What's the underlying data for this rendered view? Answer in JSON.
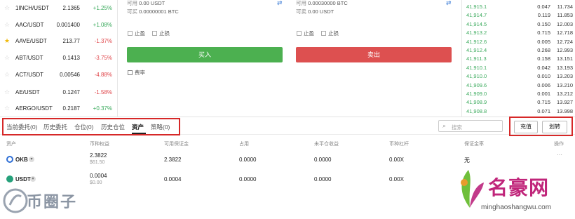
{
  "market": [
    {
      "pair": "1INCH/USDT",
      "price": "2.1365",
      "change": "+1.25%",
      "dir": "up",
      "starred": false
    },
    {
      "pair": "AAC/USDT",
      "price": "0.001400",
      "change": "+1.08%",
      "dir": "up",
      "starred": false
    },
    {
      "pair": "AAVE/USDT",
      "price": "213.77",
      "change": "-1.37%",
      "dir": "down",
      "starred": true
    },
    {
      "pair": "ABT/USDT",
      "price": "0.1413",
      "change": "-3.75%",
      "dir": "down",
      "starred": false
    },
    {
      "pair": "ACT/USDT",
      "price": "0.00546",
      "change": "-4.88%",
      "dir": "down",
      "starred": false
    },
    {
      "pair": "AE/USDT",
      "price": "0.1247",
      "change": "-1.58%",
      "dir": "down",
      "starred": false
    },
    {
      "pair": "AERGO/USDT",
      "price": "0.2187",
      "change": "+0.37%",
      "dir": "up",
      "starred": false
    }
  ],
  "order": {
    "buy": {
      "avail_label": "可用",
      "avail_value": "0.00 USDT",
      "max_label": "可买",
      "max_value": "0.00000001 BTC",
      "btn": "买入"
    },
    "sell": {
      "avail_label": "可用",
      "avail_value": "0.00030000 BTC",
      "max_label": "可卖",
      "max_value": "0.00 USDT",
      "btn": "卖出"
    },
    "tp": "止盈",
    "sl": "止损",
    "fee": "费率"
  },
  "book": [
    {
      "price": "41,915.1",
      "amount": "0.047",
      "total": "11.734"
    },
    {
      "price": "41,914.7",
      "amount": "0.119",
      "total": "11.853"
    },
    {
      "price": "41,914.5",
      "amount": "0.150",
      "total": "12.003"
    },
    {
      "price": "41,913.2",
      "amount": "0.715",
      "total": "12.718"
    },
    {
      "price": "41,912.6",
      "amount": "0.005",
      "total": "12.724"
    },
    {
      "price": "41,912.4",
      "amount": "0.268",
      "total": "12.993"
    },
    {
      "price": "41,911.3",
      "amount": "0.158",
      "total": "13.151"
    },
    {
      "price": "41,910.1",
      "amount": "0.042",
      "total": "13.193"
    },
    {
      "price": "41,910.0",
      "amount": "0.010",
      "total": "13.203"
    },
    {
      "price": "41,909.6",
      "amount": "0.006",
      "total": "13.210"
    },
    {
      "price": "41,909.0",
      "amount": "0.001",
      "total": "13.212"
    },
    {
      "price": "41,908.9",
      "amount": "0.715",
      "total": "13.927"
    },
    {
      "price": "41,908.8",
      "amount": "0.071",
      "total": "13.998"
    }
  ],
  "tabs": [
    "当前委托(0)",
    "历史委托",
    "仓位(0)",
    "历史仓位",
    "资产",
    "策略(0)"
  ],
  "search_placeholder": "搜索",
  "actions": {
    "deposit": "充值",
    "transfer": "划转"
  },
  "table": {
    "headers": [
      "资产",
      "币种权益",
      "可用保证金",
      "占用",
      "未平仓收益",
      "币种杠杆",
      "保证金率",
      "操作"
    ],
    "more": "···",
    "rows": [
      {
        "asset": "OKB",
        "equity": "2.3822",
        "equity_usd": "$61.50",
        "available": "2.3822",
        "used": "0.0000",
        "upl": "0.0000",
        "leverage": "0.00X",
        "margin_ratio": "无"
      },
      {
        "asset": "USDT",
        "equity": "0.0004",
        "equity_usd": "$0.00",
        "available": "0.0004",
        "used": "0.0000",
        "upl": "0.0000",
        "leverage": "0.00X",
        "margin_ratio": ""
      }
    ]
  },
  "watermarks": {
    "left": "币圈子",
    "right_cn": "名豪网",
    "right_url": "minghaoshangwu.com"
  },
  "colors": {
    "up": "#3aaa5c",
    "down": "#e0474c",
    "buy": "#4cb050",
    "sell": "#dd5050",
    "highlight": "#d62828"
  }
}
